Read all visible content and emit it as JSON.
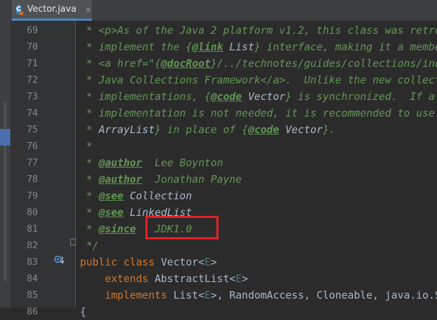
{
  "tab": {
    "filename": "Vector.java",
    "close_glyph": "×",
    "icon": "java-class-icon"
  },
  "lines": [
    {
      "number": "69",
      "parts": [
        [
          "doc",
          " * "
        ],
        [
          "doc",
          "<p>As of the Java 2 platform v1.2, this class was retro"
        ]
      ]
    },
    {
      "number": "70",
      "parts": [
        [
          "doc",
          " * implement the {"
        ],
        [
          "tag",
          "@link"
        ],
        [
          "doc",
          " "
        ],
        [
          "ref",
          "List"
        ],
        [
          "doc",
          "} interface, making it a membe"
        ]
      ]
    },
    {
      "number": "71",
      "parts": [
        [
          "doc",
          " * <a href=\"{"
        ],
        [
          "tag",
          "@docRoot"
        ],
        [
          "doc",
          "}/../technotes/guides/collections/ind"
        ]
      ]
    },
    {
      "number": "72",
      "parts": [
        [
          "doc",
          " * Java Collections Framework</a>.  Unlike the new collect"
        ]
      ]
    },
    {
      "number": "73",
      "parts": [
        [
          "doc",
          " * implementations, {"
        ],
        [
          "tag",
          "@code"
        ],
        [
          "doc",
          " "
        ],
        [
          "ref",
          "Vector"
        ],
        [
          "doc",
          "} is synchronized.  If a"
        ]
      ]
    },
    {
      "number": "74",
      "parts": [
        [
          "doc",
          " * implementation is not needed, it is recommended to use"
        ]
      ]
    },
    {
      "number": "75",
      "parts": [
        [
          "doc",
          " * "
        ],
        [
          "ref",
          "ArrayList"
        ],
        [
          "doc",
          "} in place of {"
        ],
        [
          "tag",
          "@code"
        ],
        [
          "doc",
          " "
        ],
        [
          "ref",
          "Vector"
        ],
        [
          "doc",
          "}."
        ]
      ]
    },
    {
      "number": "76",
      "parts": [
        [
          "doc",
          " *"
        ]
      ]
    },
    {
      "number": "77",
      "parts": [
        [
          "doc",
          " * "
        ],
        [
          "tag",
          "@author"
        ],
        [
          "doc",
          "  Lee Boynton"
        ]
      ]
    },
    {
      "number": "78",
      "parts": [
        [
          "doc",
          " * "
        ],
        [
          "tag",
          "@author"
        ],
        [
          "doc",
          "  Jonathan Payne"
        ]
      ]
    },
    {
      "number": "79",
      "parts": [
        [
          "doc",
          " * "
        ],
        [
          "tag",
          "@see"
        ],
        [
          "doc",
          " "
        ],
        [
          "ref",
          "Collection"
        ]
      ]
    },
    {
      "number": "80",
      "parts": [
        [
          "doc",
          " * "
        ],
        [
          "tag",
          "@see"
        ],
        [
          "doc",
          " "
        ],
        [
          "ref",
          "LinkedList"
        ]
      ]
    },
    {
      "number": "81",
      "parts": [
        [
          "doc",
          " * "
        ],
        [
          "tag",
          "@since"
        ],
        [
          "doc",
          "   JDK1.0"
        ]
      ]
    },
    {
      "number": "82",
      "parts": [
        [
          "doc",
          " */"
        ]
      ]
    },
    {
      "number": "83",
      "parts": [
        [
          "kw",
          "public class "
        ],
        [
          "plain",
          "Vector<"
        ],
        [
          "tparam",
          "E"
        ],
        [
          "plain",
          ">"
        ]
      ]
    },
    {
      "number": "84",
      "parts": [
        [
          "plain",
          "    "
        ],
        [
          "kw",
          "extends "
        ],
        [
          "plain",
          "AbstractList<"
        ],
        [
          "tparam",
          "E"
        ],
        [
          "plain",
          ">"
        ]
      ]
    },
    {
      "number": "85",
      "parts": [
        [
          "plain",
          "    "
        ],
        [
          "kw",
          "implements "
        ],
        [
          "plain",
          "List<"
        ],
        [
          "tparam",
          "E"
        ],
        [
          "plain",
          ">, RandomAccess, Cloneable, java.io.S"
        ]
      ]
    },
    {
      "number": "86",
      "parts": [
        [
          "plain",
          "{"
        ]
      ]
    }
  ],
  "colors": {
    "doc_comment": "#629755",
    "keyword": "#cc7832",
    "text": "#a9b7c6",
    "type_param": "#507874",
    "highlight": "#e8202a",
    "tab_underline": "#4a88c7"
  },
  "icons": [
    "java-class-icon",
    "close-icon",
    "fold-marker-icon",
    "implementation-gutter-icon"
  ]
}
